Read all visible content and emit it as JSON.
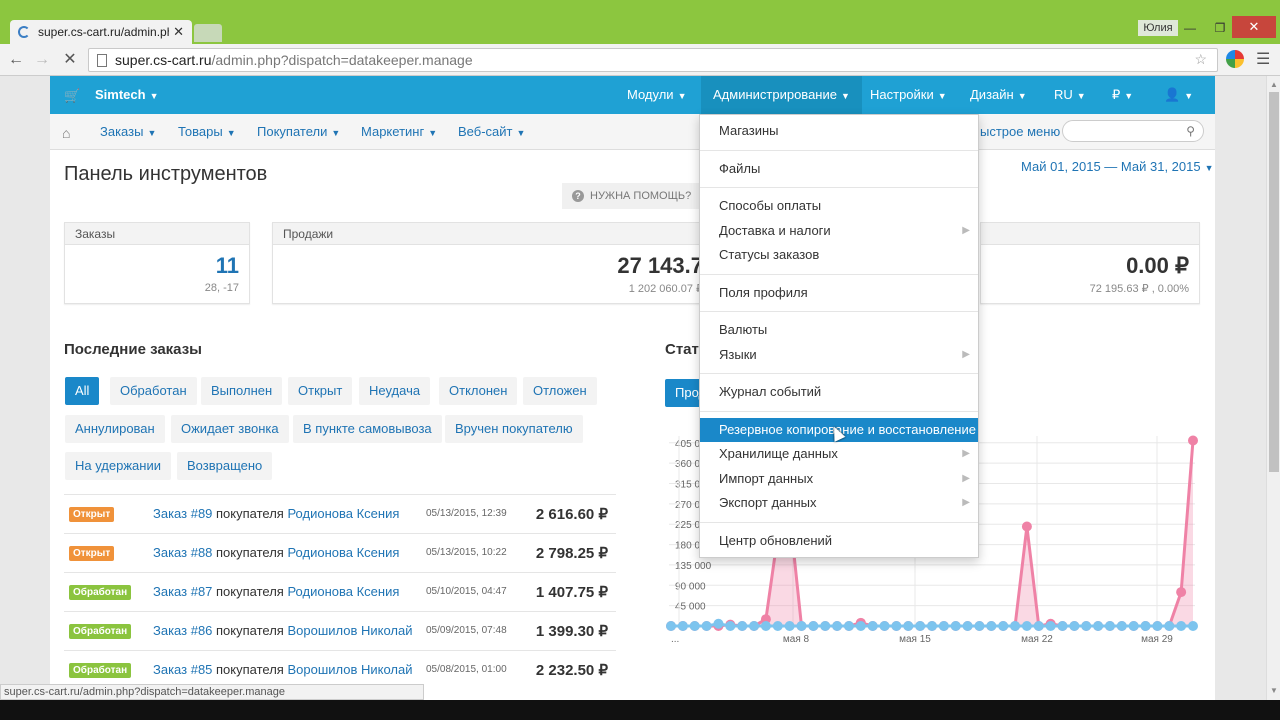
{
  "browser": {
    "tab_title": "super.cs-cart.ru/admin.ph",
    "tab_close": "✕",
    "user_chip": "Юлия",
    "url_host": "super.cs-cart.ru",
    "url_path": "/admin.php?dispatch=datakeeper.manage",
    "status_url": "super.cs-cart.ru/admin.php?dispatch=datakeeper.manage"
  },
  "topbar": {
    "brand": "Simtech",
    "menus": [
      "Модули",
      "Администрирование",
      "Настройки",
      "Дизайн",
      "RU",
      "₽"
    ]
  },
  "subbar": {
    "items": [
      "Заказы",
      "Товары",
      "Покупатели",
      "Маркетинг",
      "Веб-сайт"
    ],
    "quick_menu": "ыстрое меню"
  },
  "page": {
    "title": "Панель инструментов",
    "help": "НУЖНА ПОМОЩЬ?",
    "period": "Май 01, 2015 — Май 31, 2015"
  },
  "kpis": [
    {
      "label": "Заказы",
      "value": "11",
      "sub": "28, -17"
    },
    {
      "label": "Продажи",
      "value": "27 143.7",
      "sub": "1 202 060.07 ₽"
    },
    {
      "label": "",
      "value": "0.00 ₽",
      "sub": "72 195.63 ₽ , 0.00%"
    }
  ],
  "recent_orders": {
    "title": "Последние заказы",
    "filters": [
      "All",
      "Обработан",
      "Выполнен",
      "Открыт",
      "Неудача",
      "Отклонен",
      "Отложен",
      "Аннулирован",
      "Ожидает звонка",
      "В пункте самовывоза",
      "Вручен покупателю",
      "На удержании",
      "Возвращено"
    ],
    "buyer_word": " покупателя ",
    "rows": [
      {
        "status": "Открыт",
        "kind": "open",
        "order": "Заказ #89",
        "customer": "Родионова Ксения",
        "date": "05/13/2015, 12:39",
        "total": "2 616.60 ₽"
      },
      {
        "status": "Открыт",
        "kind": "open",
        "order": "Заказ #88",
        "customer": "Родионова Ксения",
        "date": "05/13/2015, 10:22",
        "total": "2 798.25 ₽"
      },
      {
        "status": "Обработан",
        "kind": "done",
        "order": "Заказ #87",
        "customer": "Родионова Ксения",
        "date": "05/10/2015, 04:47",
        "total": "1 407.75 ₽"
      },
      {
        "status": "Обработан",
        "kind": "done",
        "order": "Заказ #86",
        "customer": "Ворошилов Николай",
        "date": "05/09/2015, 07:48",
        "total": "1 399.30 ₽"
      },
      {
        "status": "Обработан",
        "kind": "done",
        "order": "Заказ #85",
        "customer": "Ворошилов Николай",
        "date": "05/08/2015, 01:00",
        "total": "2 232.50 ₽"
      }
    ]
  },
  "stats": {
    "title": "Стат",
    "button": "Прод"
  },
  "chart_data": {
    "type": "line",
    "y_ticks": [
      "405 0",
      "360 0",
      "315 0",
      "270 0",
      "225 0",
      "180 0",
      "135 000",
      "90 000",
      "45 000"
    ],
    "x_labels": [
      "...",
      "мая 8",
      "мая 15",
      "мая 22",
      "мая 29"
    ],
    "ylim": [
      0,
      420000
    ],
    "series": [
      {
        "color": "#ef82a6",
        "values": [
          0,
          0,
          0,
          0,
          0,
          3000,
          0,
          0,
          15000,
          200000,
          250000,
          0,
          0,
          0,
          0,
          0,
          7000,
          0,
          0,
          0,
          0,
          0,
          0,
          0,
          0,
          0,
          0,
          0,
          0,
          0,
          220000,
          0,
          5000,
          0,
          0,
          0,
          0,
          0,
          0,
          0,
          0,
          0,
          0,
          75000,
          410000
        ]
      },
      {
        "color": "#7dc4ee",
        "values": [
          0,
          0,
          0,
          0,
          5000,
          0,
          0,
          0,
          0,
          0,
          0,
          0,
          0,
          0,
          0,
          0,
          0,
          0,
          0,
          0,
          0,
          0,
          0,
          0,
          0,
          0,
          0,
          0,
          0,
          0,
          0,
          0,
          0,
          0,
          0,
          0,
          0,
          0,
          0,
          0,
          0,
          0,
          0,
          0,
          0
        ]
      }
    ]
  },
  "admin_menu": {
    "items": [
      {
        "label": "Магазины",
        "sub": false,
        "hl": false
      },
      {
        "label": "Файлы",
        "sub": false,
        "hl": false
      },
      {
        "label": "Способы оплаты",
        "sub": false,
        "hl": false
      },
      {
        "label": "Доставка и налоги",
        "sub": true,
        "hl": false
      },
      {
        "label": "Статусы заказов",
        "sub": false,
        "hl": false
      },
      {
        "label": "Поля профиля",
        "sub": false,
        "hl": false
      },
      {
        "label": "Валюты",
        "sub": false,
        "hl": false
      },
      {
        "label": "Языки",
        "sub": true,
        "hl": false
      },
      {
        "label": "Журнал событий",
        "sub": false,
        "hl": false
      },
      {
        "label": "Резервное копирование и восстановление",
        "sub": false,
        "hl": true
      },
      {
        "label": "Хранилище данных",
        "sub": true,
        "hl": false
      },
      {
        "label": "Импорт данных",
        "sub": true,
        "hl": false
      },
      {
        "label": "Экспорт данных",
        "sub": true,
        "hl": false
      },
      {
        "label": "Центр обновлений",
        "sub": false,
        "hl": false
      }
    ]
  }
}
